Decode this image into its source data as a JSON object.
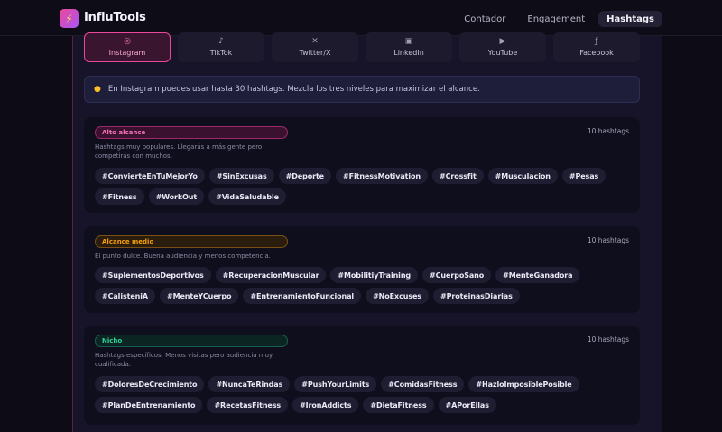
{
  "header": {
    "brand": "InfluTools",
    "nav": [
      {
        "label": "Contador",
        "active": false
      },
      {
        "label": "Engagement",
        "active": false
      },
      {
        "label": "Hashtags",
        "active": true
      }
    ]
  },
  "platforms": [
    {
      "label": "Instagram",
      "icon": "instagram-icon",
      "active": true
    },
    {
      "label": "TikTok",
      "icon": "tiktok-icon",
      "active": false
    },
    {
      "label": "Twitter/X",
      "icon": "x-icon",
      "active": false
    },
    {
      "label": "LinkedIn",
      "icon": "linkedin-icon",
      "active": false
    },
    {
      "label": "YouTube",
      "icon": "youtube-icon",
      "active": false
    },
    {
      "label": "Facebook",
      "icon": "facebook-icon",
      "active": false
    }
  ],
  "tip": {
    "text": "En Instagram puedes usar hasta 30 hashtags. Mezcla los tres niveles para maximizar el alcance."
  },
  "groups": [
    {
      "level": "Alto alcance",
      "count": "10 hashtags",
      "description": "Hashtags muy populares. Llegarás a más gente pero competirás con muchos.",
      "tags": [
        "#ConvierteEnTuMejorYo",
        "#SinExcusas",
        "#Deporte",
        "#FitnessMotivation",
        "#Crossfit",
        "#Musculacion",
        "#Pesas",
        "#Fitness",
        "#WorkOut",
        "#VidaSaludable"
      ]
    },
    {
      "level": "Alcance medio",
      "count": "10 hashtags",
      "description": "El punto dulce. Buena audiencia y menos competencia.",
      "tags": [
        "#SuplementosDeportivos",
        "#RecuperacionMuscular",
        "#MobilitiyTraining",
        "#CuerpoSano",
        "#MenteGanadora",
        "#CalisteniA",
        "#MenteYCuerpo",
        "#EntrenamientoFuncional",
        "#NoExcuses",
        "#ProteinasDiarias"
      ]
    },
    {
      "level": "Nicho",
      "count": "10 hashtags",
      "description": "Hashtags específicos. Menos visitas pero audiencia muy cualificada.",
      "tags": [
        "#DoloresDeCrecimiento",
        "#NuncaTeRindas",
        "#PushYourLimits",
        "#ComidasFitness",
        "#HazloImposiblePosible",
        "#PlanDeEntrenamiento",
        "#RecetasFitness",
        "#IronAddicts",
        "#DietaFitness",
        "#APorEllas"
      ]
    }
  ]
}
